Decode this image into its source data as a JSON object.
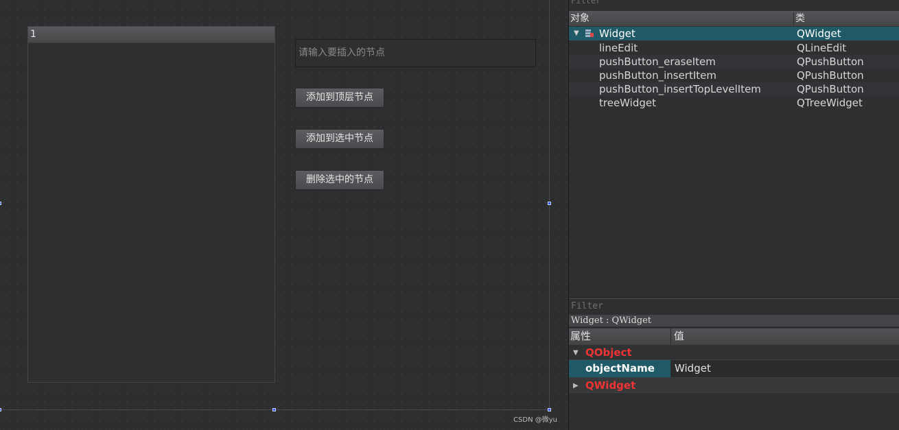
{
  "canvas": {
    "tree_header": "1",
    "line_edit_placeholder": "请输入要插入的节点",
    "buttons": {
      "insert_top": "添加到顶层节点",
      "insert_selected": "添加到选中节点",
      "erase_selected": "删除选中的节点"
    },
    "watermark": "CSDN @微yu"
  },
  "object_inspector": {
    "filter_label": "Filter",
    "headers": {
      "object": "对象",
      "class": "类"
    },
    "root": {
      "name": "Widget",
      "class": "QWidget",
      "icon": "widget-icon"
    },
    "children": [
      {
        "name": "lineEdit",
        "class": "QLineEdit"
      },
      {
        "name": "pushButton_eraseItem",
        "class": "QPushButton"
      },
      {
        "name": "pushButton_insertItem",
        "class": "QPushButton"
      },
      {
        "name": "pushButton_insertTopLevelItem",
        "class": "QPushButton"
      },
      {
        "name": "treeWidget",
        "class": "QTreeWidget"
      }
    ]
  },
  "property_editor": {
    "filter_label": "Filter",
    "class_line": "Widget : QWidget",
    "headers": {
      "property": "属性",
      "value": "值"
    },
    "groups": [
      {
        "name": "QObject",
        "expanded": true
      },
      {
        "name": "QWidget",
        "expanded": false
      }
    ],
    "object_name_row": {
      "key": "objectName",
      "value": "Widget"
    }
  },
  "colors": {
    "selection": "#1f5a66",
    "group_label": "#ef3434",
    "handle": "#2f5bff"
  }
}
